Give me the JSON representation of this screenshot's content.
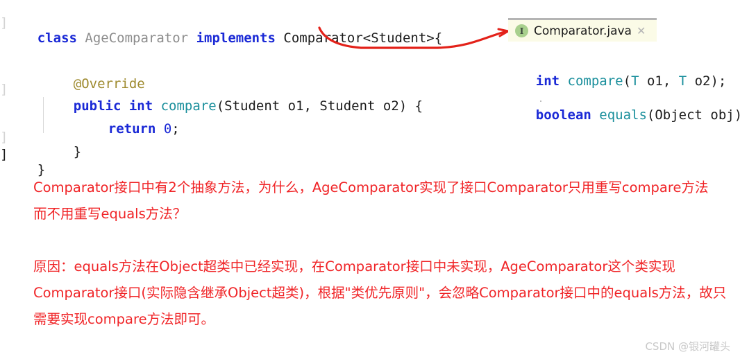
{
  "editor": {
    "gutter_markers": [
      "]",
      "]",
      "]",
      "]"
    ],
    "lines": [
      {
        "id": "line-class-decl",
        "tokens": [
          {
            "text": "class ",
            "style": "kw"
          },
          {
            "text": "AgeComparator ",
            "style": "cls"
          },
          {
            "text": "implements ",
            "style": "kw"
          },
          {
            "text": "Comparator<Student>{",
            "style": "plain"
          }
        ]
      },
      {
        "id": "line-override",
        "tokens": [
          {
            "text": "@Override",
            "style": "anno"
          }
        ]
      },
      {
        "id": "line-compare-signature",
        "tokens": [
          {
            "text": "public int ",
            "style": "kw"
          },
          {
            "text": "compare",
            "style": "method"
          },
          {
            "text": "(Student o1, Student o2) {",
            "style": "plain"
          }
        ]
      },
      {
        "id": "line-return",
        "tokens": [
          {
            "text": "return ",
            "style": "kw"
          },
          {
            "text": "0",
            "style": "num"
          },
          {
            "text": ";",
            "style": "plain"
          }
        ]
      },
      {
        "id": "line-close-method",
        "tokens": [
          {
            "text": "}",
            "style": "plain"
          }
        ]
      },
      {
        "id": "line-close-class",
        "tokens": [
          {
            "text": "}",
            "style": "plain"
          }
        ]
      }
    ]
  },
  "popup": {
    "tab_title": "Comparator.java",
    "icon_glyph": "I",
    "icon_name": "interface-icon",
    "close_glyph": "✕",
    "accent_bg": "#fbfbe7",
    "icon_bg": "#a8d08d",
    "lines": [
      {
        "id": "popup-line-compare",
        "tokens": [
          {
            "text": "int ",
            "style": "kw"
          },
          {
            "text": "compare",
            "style": "method"
          },
          {
            "text": "(",
            "style": "plain"
          },
          {
            "text": "T",
            "style": "method"
          },
          {
            "text": " o1, ",
            "style": "plain"
          },
          {
            "text": "T",
            "style": "method"
          },
          {
            "text": " o2);",
            "style": "plain"
          }
        ]
      },
      {
        "id": "popup-line-equals",
        "tokens": [
          {
            "text": "boolean ",
            "style": "kw"
          },
          {
            "text": "equals",
            "style": "method"
          },
          {
            "text": "(Object obj);",
            "style": "plain"
          }
        ]
      }
    ]
  },
  "annotations": {
    "arrow_color": "#e32119",
    "text_color": "#f02427",
    "question": "Comparator接口中有2个抽象方法，为什么，AgeComparator实现了接口Comparator只用重写compare方法而不用重写equals方法？",
    "reason": "原因：equals方法在Object超类中已经实现，在Comparator接口中未实现，AgeComparator这个类实现Comparator接口(实际隐含继承Object超类)，根据\"类优先原则\"，会忽略Comparator接口中的equals方法，故只需要实现compare方法即可。"
  },
  "watermark": {
    "text": "CSDN @银河罐头"
  }
}
